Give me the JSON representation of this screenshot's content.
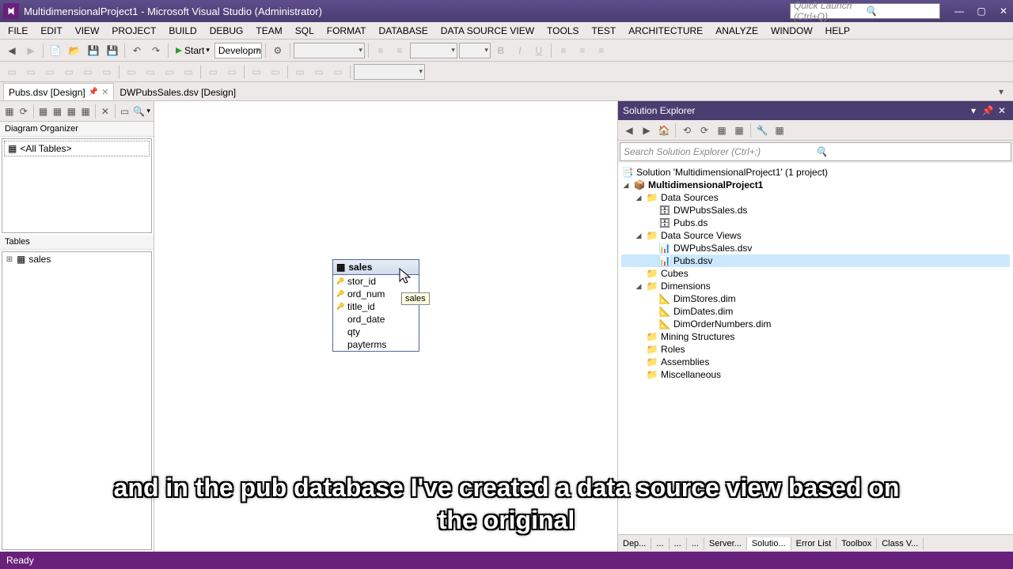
{
  "title": "MultidimensionalProject1 - Microsoft Visual Studio (Administrator)",
  "quick_launch_placeholder": "Quick Launch (Ctrl+Q)",
  "menu": [
    "FILE",
    "EDIT",
    "VIEW",
    "PROJECT",
    "BUILD",
    "DEBUG",
    "TEAM",
    "SQL",
    "FORMAT",
    "DATABASE",
    "DATA SOURCE VIEW",
    "TOOLS",
    "TEST",
    "ARCHITECTURE",
    "ANALYZE",
    "WINDOW",
    "HELP"
  ],
  "toolbar": {
    "start_label": "Start",
    "config": "Developm"
  },
  "tabs": {
    "active": "Pubs.dsv [Design]",
    "other": "DWPubsSales.dsv [Design]"
  },
  "diagram_organizer": {
    "label": "Diagram Organizer",
    "item": "<All Tables>"
  },
  "tables_panel": {
    "label": "Tables",
    "item": "sales"
  },
  "table_box": {
    "name": "sales",
    "tooltip": "sales",
    "columns": [
      {
        "name": "stor_id",
        "key": true
      },
      {
        "name": "ord_num",
        "key": true
      },
      {
        "name": "title_id",
        "key": true
      },
      {
        "name": "ord_date",
        "key": false
      },
      {
        "name": "qty",
        "key": false
      },
      {
        "name": "payterms",
        "key": false
      }
    ]
  },
  "solution_explorer": {
    "title": "Solution Explorer",
    "search_placeholder": "Search Solution Explorer (Ctrl+;)",
    "solution": "Solution 'MultidimensionalProject1' (1 project)",
    "project": "MultidimensionalProject1",
    "folders": {
      "data_sources": {
        "label": "Data Sources",
        "items": [
          "DWPubsSales.ds",
          "Pubs.ds"
        ]
      },
      "data_source_views": {
        "label": "Data Source Views",
        "items": [
          "DWPubsSales.dsv",
          "Pubs.dsv"
        ]
      },
      "cubes": {
        "label": "Cubes"
      },
      "dimensions": {
        "label": "Dimensions",
        "items": [
          "DimStores.dim",
          "DimDates.dim",
          "DimOrderNumbers.dim"
        ]
      },
      "mining": {
        "label": "Mining Structures"
      },
      "roles": {
        "label": "Roles"
      },
      "assemblies": {
        "label": "Assemblies"
      },
      "misc": {
        "label": "Miscellaneous"
      }
    }
  },
  "bottom_tabs": [
    "Dep...",
    "...",
    "...",
    "...",
    "Server...",
    "Solutio...",
    "Error List",
    "Toolbox",
    "Class V..."
  ],
  "status": "Ready",
  "subtitle": "and in the pub database I've created a data source view based on the original"
}
